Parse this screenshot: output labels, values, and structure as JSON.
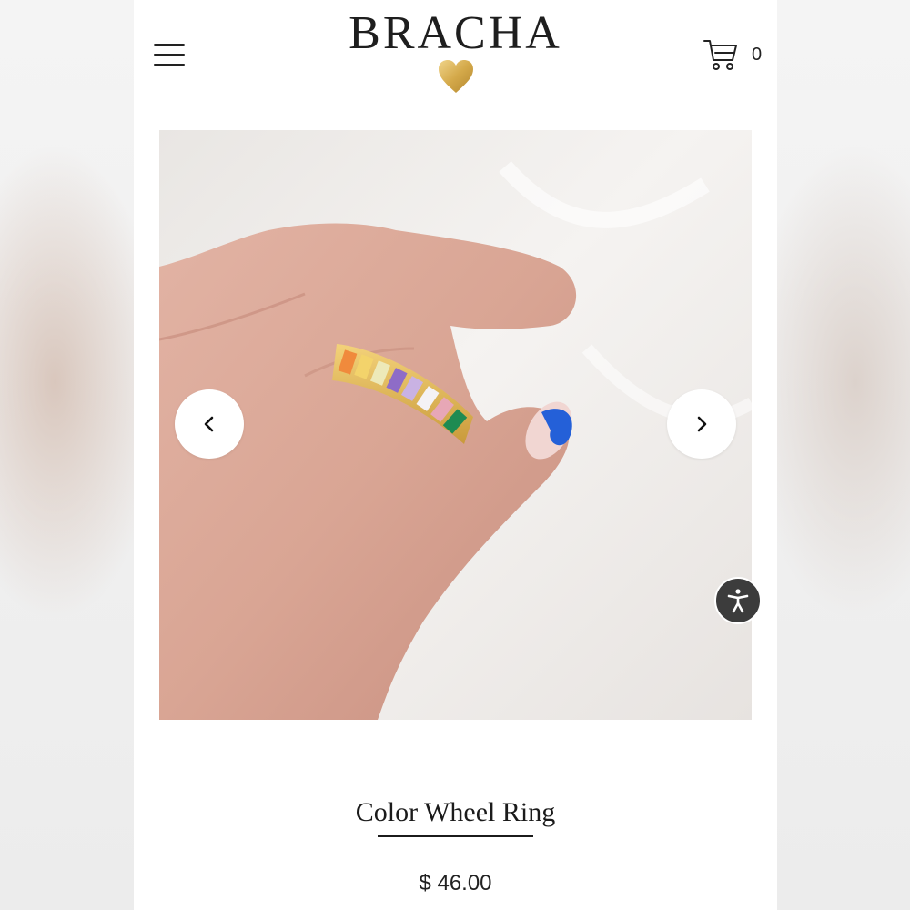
{
  "header": {
    "brand_name": "BRACHA",
    "cart_count": "0",
    "heart_color": "#d4a94a"
  },
  "gallery": {
    "image": "gold ring with rainbow baguette stones worn on hand",
    "prev_icon": "chevron-left-icon",
    "next_icon": "chevron-right-icon"
  },
  "accessibility": {
    "icon": "accessibility-icon"
  },
  "product": {
    "title": "Color Wheel Ring",
    "price": "$ 46.00"
  }
}
